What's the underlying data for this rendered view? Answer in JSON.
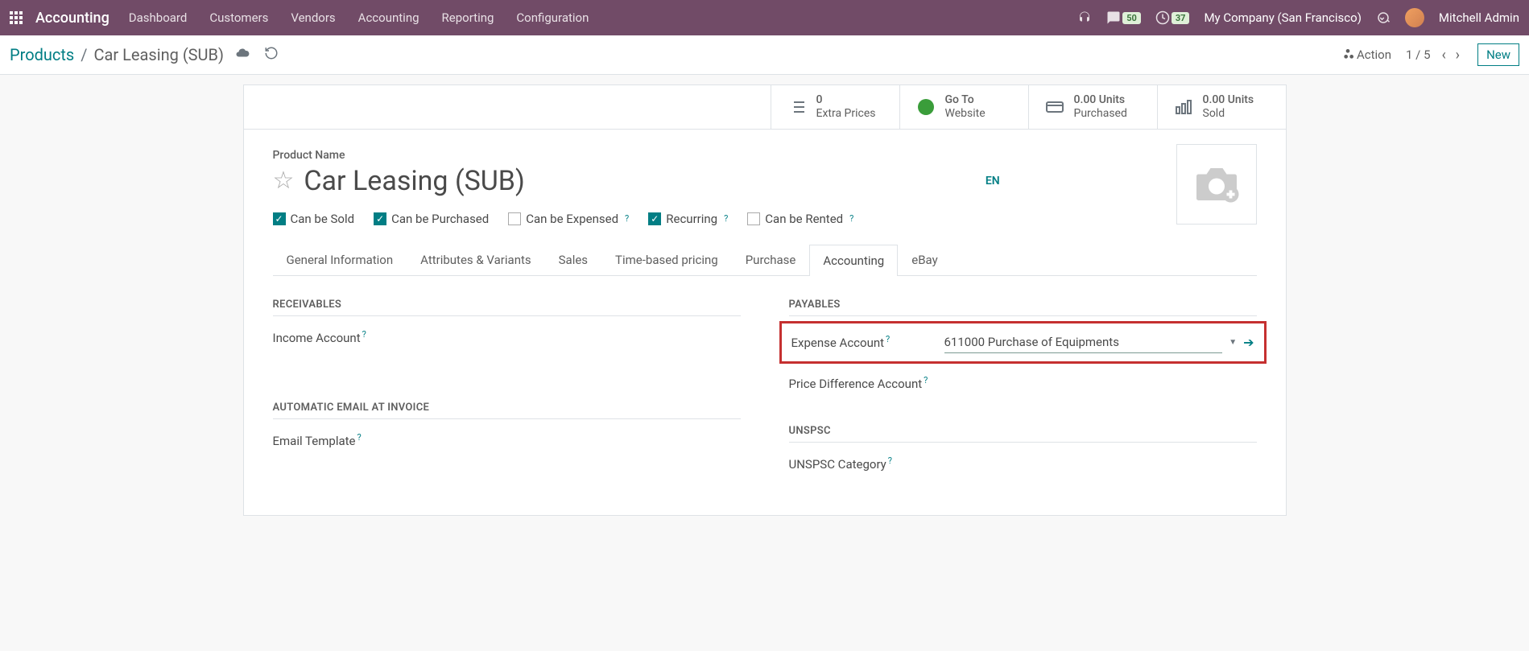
{
  "nav": {
    "brand": "Accounting",
    "menu": [
      "Dashboard",
      "Customers",
      "Vendors",
      "Accounting",
      "Reporting",
      "Configuration"
    ],
    "messages_badge": "50",
    "activities_badge": "37",
    "company": "My Company (San Francisco)",
    "user": "Mitchell Admin"
  },
  "breadcrumb": {
    "parent": "Products",
    "current": "Car Leasing (SUB)"
  },
  "actions": {
    "action_label": "Action",
    "pager": "1 / 5",
    "new_label": "New"
  },
  "stats": {
    "extra_prices_val": "0",
    "extra_prices_label": "Extra Prices",
    "website_val": "Go To",
    "website_label": "Website",
    "purchased_val": "0.00 Units",
    "purchased_label": "Purchased",
    "sold_val": "0.00 Units",
    "sold_label": "Sold"
  },
  "product": {
    "label": "Product Name",
    "name": "Car Leasing (SUB)",
    "lang": "EN"
  },
  "checks": {
    "sold": "Can be Sold",
    "purchased": "Can be Purchased",
    "expensed": "Can be Expensed",
    "recurring": "Recurring",
    "rented": "Can be Rented"
  },
  "tabs": [
    "General Information",
    "Attributes & Variants",
    "Sales",
    "Time-based pricing",
    "Purchase",
    "Accounting",
    "eBay"
  ],
  "sections": {
    "receivables": "RECEIVABLES",
    "payables": "PAYABLES",
    "auto_email": "AUTOMATIC EMAIL AT INVOICE",
    "unspsc": "UNSPSC"
  },
  "fields": {
    "income_account": "Income Account",
    "expense_account": "Expense Account",
    "expense_account_value": "611000 Purchase of Equipments",
    "price_diff": "Price Difference Account",
    "email_template": "Email Template",
    "unspsc_cat": "UNSPSC Category"
  }
}
